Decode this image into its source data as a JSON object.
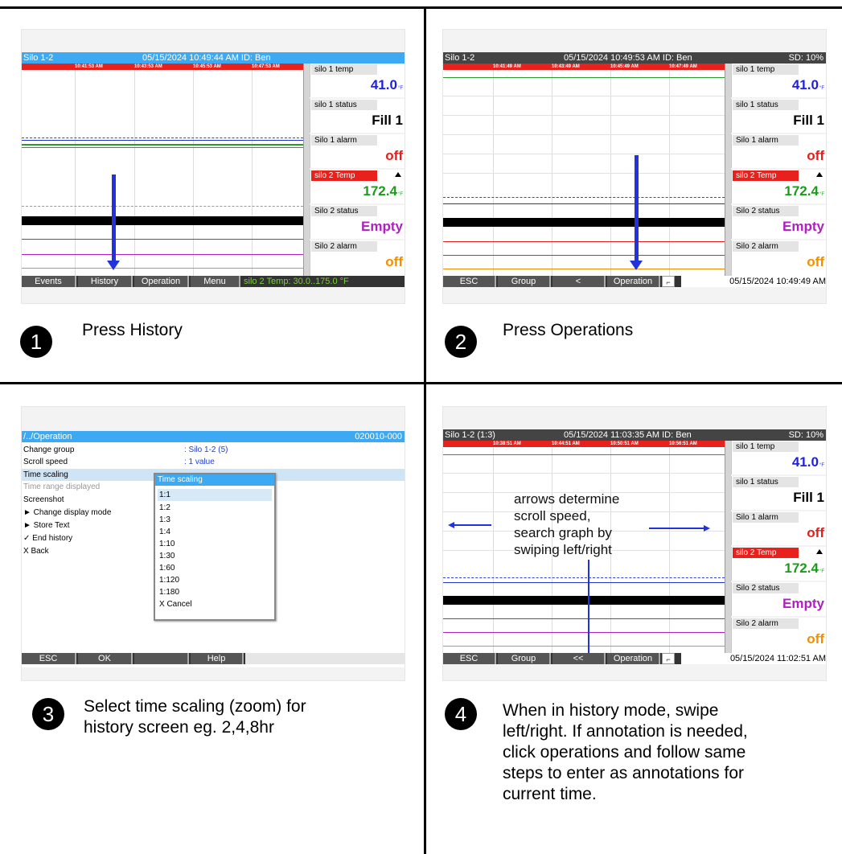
{
  "panel1": {
    "title_left": "Silo 1-2",
    "title_center": "05/15/2024 10:49:44 AM  ID: Ben",
    "title_right": "",
    "times": [
      "10:41:53 AM",
      "10:43:53 AM",
      "10:45:53 AM",
      "10:47:53 AM"
    ],
    "channels": [
      {
        "name": "silo 1 temp",
        "value": "41.0",
        "unit": "°F",
        "color": "#1f1fe0"
      },
      {
        "name": "silo 1 status",
        "value": "Fill 1",
        "unit": "",
        "color": "#000000"
      },
      {
        "name": "Silo 1 alarm",
        "value": "off",
        "unit": "",
        "color": "#e0201c"
      },
      {
        "name": "silo 2 Temp",
        "value": "172.4",
        "unit": "°F",
        "color": "#1a9c1a"
      },
      {
        "name": "Silo 2 status",
        "value": "Empty",
        "unit": "",
        "color": "#b020c0"
      },
      {
        "name": "Silo 2 alarm",
        "value": "off",
        "unit": "",
        "color": "#f09000"
      }
    ],
    "buttons": [
      "Events",
      "History",
      "Operation",
      "Menu"
    ],
    "status": "silo 2 Temp: 30.0..175.0 °F"
  },
  "panel2": {
    "title_left": "Silo 1-2",
    "title_center": "05/15/2024 10:49:53 AM  ID: Ben",
    "title_right": "SD: 10%",
    "times": [
      "10:41:49 AM",
      "10:43:49 AM",
      "10:45:49 AM",
      "10:47:49 AM"
    ],
    "channels": [
      {
        "name": "silo 1 temp",
        "value": "41.0",
        "unit": "°F",
        "color": "#1f1fe0"
      },
      {
        "name": "silo 1 status",
        "value": "Fill 1",
        "unit": "",
        "color": "#000000"
      },
      {
        "name": "Silo 1 alarm",
        "value": "off",
        "unit": "",
        "color": "#e0201c"
      },
      {
        "name": "silo 2 Temp",
        "value": "172.4",
        "unit": "°F",
        "color": "#1a9c1a"
      },
      {
        "name": "Silo 2 status",
        "value": "Empty",
        "unit": "",
        "color": "#b020c0"
      },
      {
        "name": "Silo 2 alarm",
        "value": "off",
        "unit": "",
        "color": "#f09000"
      }
    ],
    "buttons": [
      "ESC",
      "Group",
      "<",
      "Operation"
    ],
    "status": "05/15/2024 10:49:49 AM"
  },
  "panel3": {
    "path": "/../Operation",
    "code": "020010-000",
    "options": [
      {
        "label": "Change group",
        "value": ": Silo 1-2 (5)"
      },
      {
        "label": "Scroll speed",
        "value": ": 1 value"
      },
      {
        "label": "Time scaling",
        "value": ""
      },
      {
        "label": "Time range displayed",
        "value": ""
      },
      {
        "label": "Screenshot",
        "value": ""
      },
      {
        "label": "► Change display mode",
        "value": ""
      },
      {
        "label": "► Store Text",
        "value": ""
      },
      {
        "label": "✓ End history",
        "value": ""
      },
      {
        "label": "X  Back",
        "value": ""
      }
    ],
    "dropdown_title": "Time scaling",
    "dropdown_items": [
      "1:1",
      "1:2",
      "1:3",
      "1:4",
      "1:10",
      "1:30",
      "1:60",
      "1:120",
      "1:180",
      "X  Cancel"
    ],
    "buttons": [
      "ESC",
      "OK",
      "",
      "Help"
    ]
  },
  "panel4": {
    "title_left": "Silo 1-2 (1:3)",
    "title_center": "05/15/2024 11:03:35 AM  ID: Ben",
    "title_right": "SD: 10%",
    "times": [
      "10:38:51 AM",
      "10:44:51 AM",
      "10:50:51 AM",
      "10:56:51 AM"
    ],
    "channels": [
      {
        "name": "silo 1 temp",
        "value": "41.0",
        "unit": "°F",
        "color": "#1f1fe0"
      },
      {
        "name": "silo 1 status",
        "value": "Fill 1",
        "unit": "",
        "color": "#000000"
      },
      {
        "name": "Silo 1 alarm",
        "value": "off",
        "unit": "",
        "color": "#e0201c"
      },
      {
        "name": "silo 2 Temp",
        "value": "172.4",
        "unit": "°F",
        "color": "#1a9c1a"
      },
      {
        "name": "Silo 2 status",
        "value": "Empty",
        "unit": "",
        "color": "#b020c0"
      },
      {
        "name": "Silo 2 alarm",
        "value": "off",
        "unit": "",
        "color": "#f09000"
      }
    ],
    "annotation": "arrows determine\nscroll speed,\nsearch graph by\nswiping left/right",
    "buttons": [
      "ESC",
      "Group",
      "<<",
      "Operation"
    ],
    "status": "05/15/2024 11:02:51 AM"
  },
  "steps": [
    {
      "num": "1",
      "text": "Press History"
    },
    {
      "num": "2",
      "text": "Press Operations"
    },
    {
      "num": "3",
      "text": "Select time scaling (zoom) for\nhistory screen eg. 2,4,8hr"
    },
    {
      "num": "4",
      "text": "When in history mode, swipe\nleft/right. If annotation is needed,\nclick operations and follow same\nsteps to enter as annotations for\ncurrent time."
    }
  ]
}
